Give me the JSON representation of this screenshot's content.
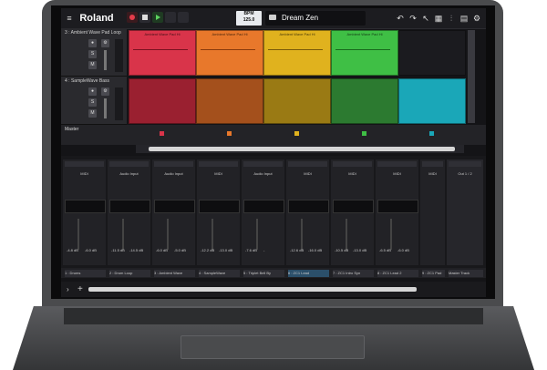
{
  "app": {
    "logo": "Roland",
    "project_name": "Dream Zen",
    "bpm": "BPM 125.0",
    "bpm_top": "BPM",
    "bpm_value": "125.0"
  },
  "tracks": [
    {
      "label": "3 : Ambient Wave Pad Loop",
      "clip_title": "Ambient Wave Pad Hi"
    },
    {
      "label": "4 : SampleWave Bass",
      "clip_title": ""
    },
    {
      "label": "Master",
      "clip_title": ""
    }
  ],
  "mixer": {
    "strips": [
      {
        "type": "MIDI",
        "db1": "-4.8 dB",
        "db2": "-6.0 dB",
        "name": "1 : Drums"
      },
      {
        "type": "Audio Input",
        "db1": "-11.5 dB",
        "db2": "-14.5 dB",
        "name": "2 : Drum Loop"
      },
      {
        "type": "Audio Input",
        "db1": "-6.0 dB",
        "db2": "-5.0 dB",
        "name": "3 : Ambient Wave"
      },
      {
        "type": "MIDI",
        "db1": "-12.2 dB",
        "db2": "-13.0 dB",
        "name": "4 : SampleWave"
      },
      {
        "type": "Audio Input",
        "db1": "-7.6 dB",
        "db2": "-",
        "name": "5 : Triplet Bell By"
      },
      {
        "type": "MIDI",
        "db1": "-12.6 dB",
        "db2": "-16.0 dB",
        "name": "6 : ZC1 Lead"
      },
      {
        "type": "MIDI",
        "db1": "-10.5 dB",
        "db2": "-13.0 dB",
        "name": "7 : ZC1 Intro Syn"
      },
      {
        "type": "MIDI",
        "db1": "-6.5 dB",
        "db2": "-6.0 dB",
        "name": "8 : ZC1 Lead 2"
      },
      {
        "type": "MIDI",
        "db1": "",
        "db2": "",
        "name": "9 : ZC1 Pad"
      },
      {
        "type": "Out 1 / 2",
        "db1": "",
        "db2": "",
        "name": "Master Track"
      }
    ]
  },
  "colors": {
    "red": "#d9344a",
    "orange": "#e8782b",
    "yellow": "#e0b21e",
    "green": "#3fbf45",
    "teal": "#1aa7b8",
    "dark_green": "#2c7a30"
  }
}
